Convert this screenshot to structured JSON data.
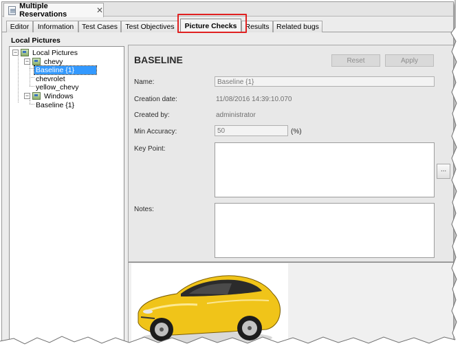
{
  "editor": {
    "title": "Multiple Reservations",
    "close_glyph": "✕"
  },
  "tabs": [
    {
      "label": "Editor"
    },
    {
      "label": "Information"
    },
    {
      "label": "Test Cases"
    },
    {
      "label": "Test Objectives"
    },
    {
      "label": "Picture Checks",
      "active": true
    },
    {
      "label": "Results"
    },
    {
      "label": "Related bugs"
    }
  ],
  "left_pane": {
    "title": "Local Pictures",
    "tree": {
      "root": "Local Pictures",
      "groups": [
        {
          "name": "chevy",
          "children": [
            "Baseline {1}",
            "chevrolet",
            "yellow_chevy"
          ]
        },
        {
          "name": "Windows",
          "children": [
            "Baseline {1}"
          ]
        }
      ]
    },
    "expander_minus": "−"
  },
  "details": {
    "heading": "BASELINE",
    "reset_label": "Reset",
    "apply_label": "Apply",
    "name_label": "Name:",
    "name_value": "Baseline {1}",
    "creation_label": "Creation date:",
    "creation_value": "11/08/2016 14:39:10.070",
    "created_by_label": "Created by:",
    "created_by_value": "administrator",
    "min_accuracy_label": "Min Accuracy:",
    "min_accuracy_value": "50",
    "min_accuracy_unit": "(%)",
    "key_point_label": "Key Point:",
    "key_point_button": "...",
    "notes_label": "Notes:"
  },
  "colors": {
    "highlight": "#e02020",
    "selection": "#3399ff",
    "car_body": "#f0c419"
  }
}
